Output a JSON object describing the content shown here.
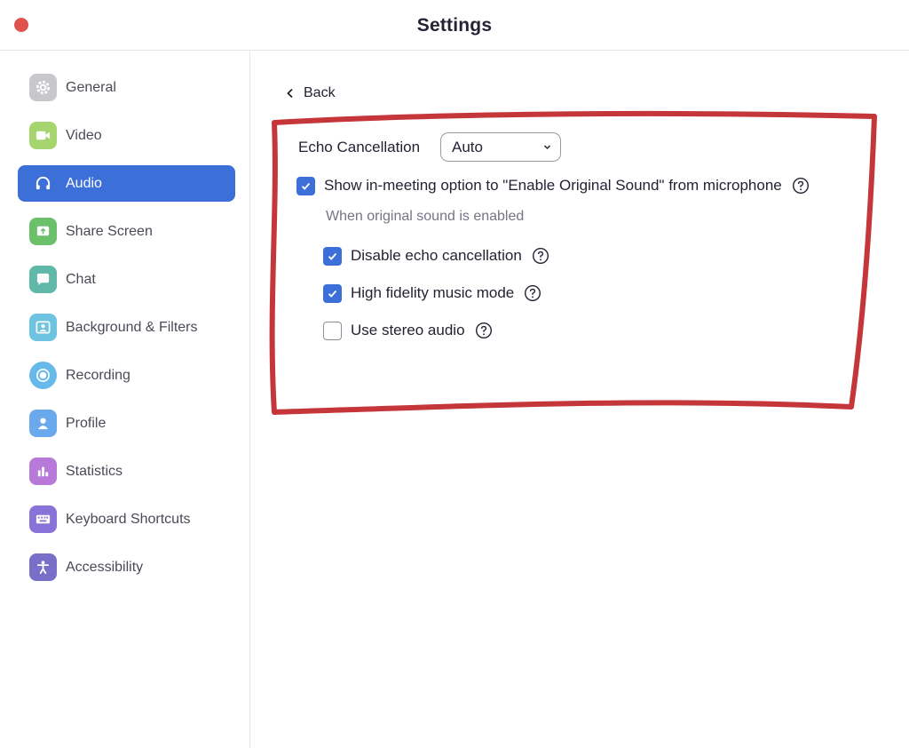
{
  "window": {
    "title": "Settings"
  },
  "colors": {
    "accent": "#3c6fd8",
    "close_button": "#e0524d",
    "annotation": "#c5363b"
  },
  "sidebar": {
    "items": [
      {
        "label": "General",
        "icon": "gear-icon",
        "color": "#c7c7cc",
        "active": false
      },
      {
        "label": "Video",
        "icon": "video-camera-icon",
        "color": "#a6d46e",
        "active": false
      },
      {
        "label": "Audio",
        "icon": "headphones-icon",
        "color": "#3c6fd8",
        "active": true
      },
      {
        "label": "Share Screen",
        "icon": "share-screen-icon",
        "color": "#6cc06a",
        "active": false
      },
      {
        "label": "Chat",
        "icon": "chat-bubble-icon",
        "color": "#5fb8a8",
        "active": false
      },
      {
        "label": "Background & Filters",
        "icon": "background-person-icon",
        "color": "#6ec3e0",
        "active": false
      },
      {
        "label": "Recording",
        "icon": "record-icon",
        "color": "#67b9ea",
        "active": false
      },
      {
        "label": "Profile",
        "icon": "profile-icon",
        "color": "#6aa9ec",
        "active": false
      },
      {
        "label": "Statistics",
        "icon": "bar-chart-icon",
        "color": "#b87ad8",
        "active": false
      },
      {
        "label": "Keyboard Shortcuts",
        "icon": "keyboard-icon",
        "color": "#8a73d8",
        "active": false
      },
      {
        "label": "Accessibility",
        "icon": "accessibility-icon",
        "color": "#7a6fc8",
        "active": false
      }
    ]
  },
  "content": {
    "back_label": "Back",
    "echo_cancellation": {
      "label": "Echo Cancellation",
      "selected": "Auto"
    },
    "original_sound": {
      "label": "Show in-meeting option to \"Enable Original Sound\" from microphone",
      "checked": true
    },
    "caption": "When original sound is enabled",
    "options": [
      {
        "label": "Disable echo cancellation",
        "checked": true
      },
      {
        "label": "High fidelity music mode",
        "checked": true
      },
      {
        "label": "Use stereo audio",
        "checked": false
      }
    ]
  }
}
